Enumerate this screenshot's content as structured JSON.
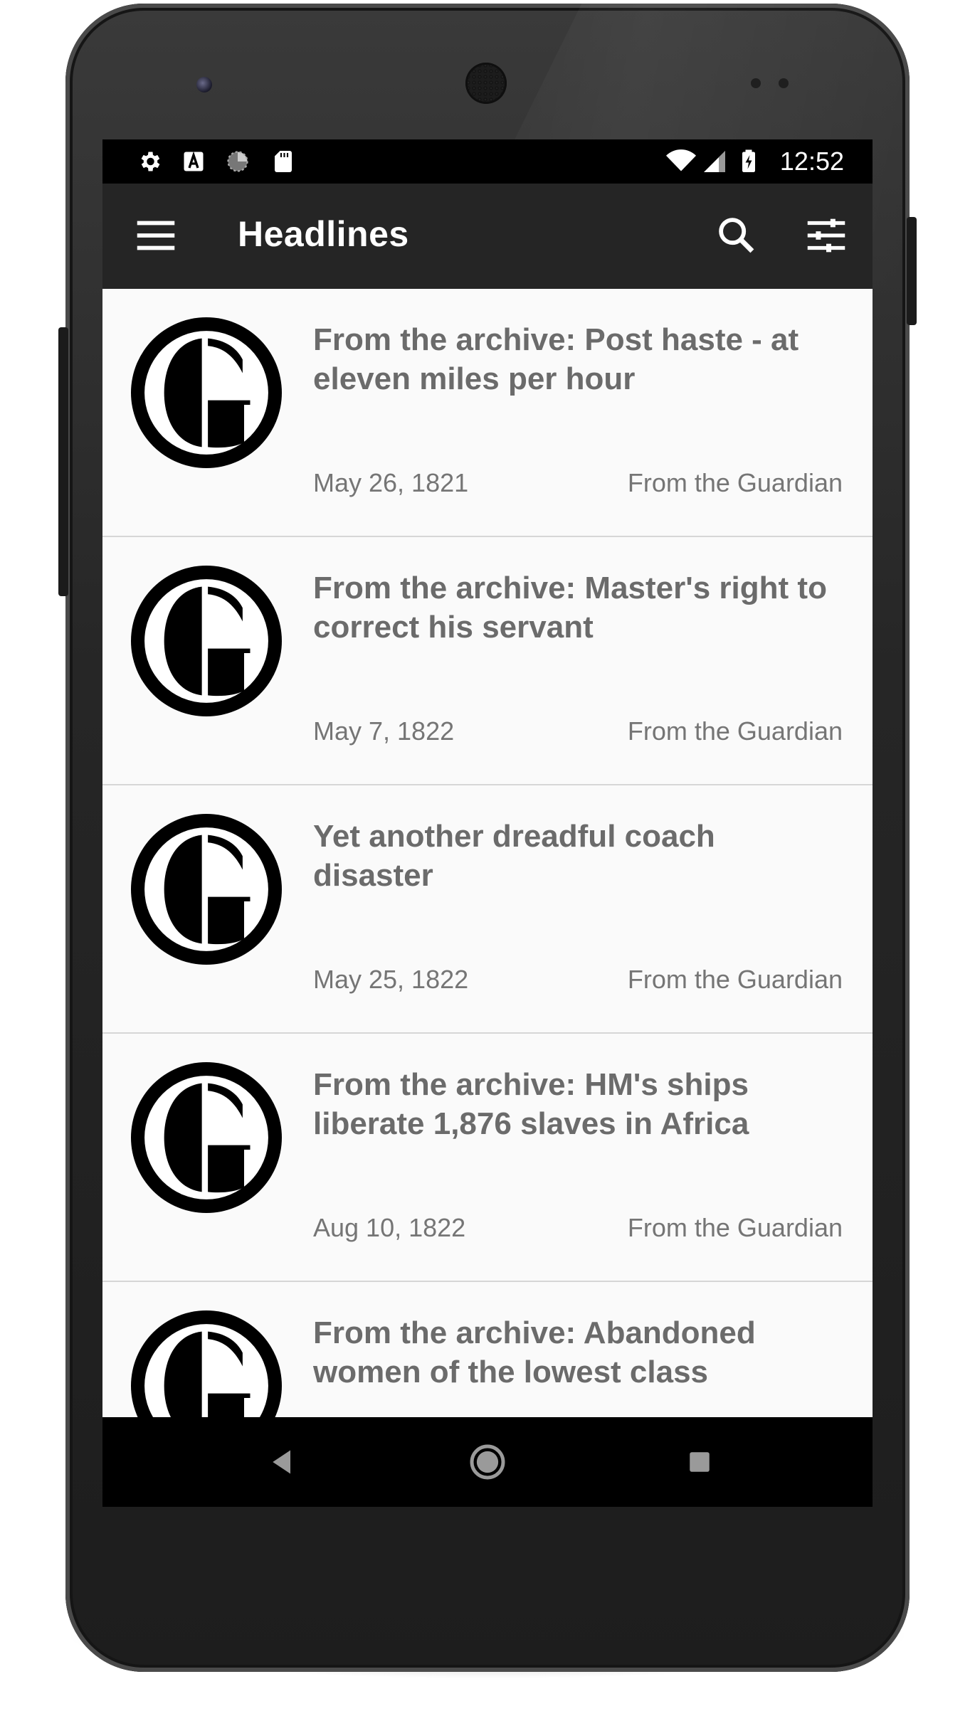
{
  "status_bar": {
    "time": "12:52",
    "left_icons": [
      "settings-icon",
      "a-icon",
      "loading-icon",
      "sd-card-icon"
    ],
    "right_icons": [
      "wifi-icon",
      "signal-icon",
      "battery-charging-icon"
    ]
  },
  "app_bar": {
    "title": "Headlines",
    "actions": [
      "search-icon",
      "filter-icon"
    ],
    "nav_icon": "menu-icon"
  },
  "headlines": [
    {
      "title": "From the archive: Post haste - at eleven miles per hour",
      "date": "May 26, 1821",
      "source": "From the Guardian"
    },
    {
      "title": "From the archive: Master's right to correct his servant",
      "date": "May 7, 1822",
      "source": "From the Guardian"
    },
    {
      "title": "Yet another dreadful coach disaster",
      "date": "May 25, 1822",
      "source": "From the Guardian"
    },
    {
      "title": "From the archive: HM's ships liberate 1,876 slaves in Africa",
      "date": "Aug 10, 1822",
      "source": "From the Guardian"
    },
    {
      "title": "From the archive: Abandoned women of the lowest class",
      "date": "",
      "source": ""
    }
  ],
  "nav_bar": [
    "back-icon",
    "home-icon",
    "recents-icon"
  ],
  "colors": {
    "app_bar": "#252525",
    "list_background": "#fafafa",
    "headline_text": "#6b6b6b",
    "meta_text": "#757575"
  }
}
